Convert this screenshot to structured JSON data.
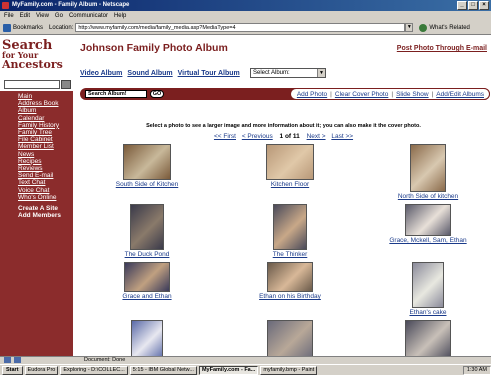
{
  "window": {
    "title": "MyFamily.com - Family Album - Netscape"
  },
  "menu": [
    "File",
    "Edit",
    "View",
    "Go",
    "Communicator",
    "Help"
  ],
  "location_bar": {
    "bookmarks_label": "Bookmarks",
    "location_label": "Location:",
    "url": "http://www.myfamily.com/media/family_media.asp?MediaType=4",
    "related_label": "What's Related"
  },
  "sidebar": {
    "logo_line1": "Search",
    "logo_line2": "for Your",
    "logo_line3": "Ancestors",
    "nav_items": [
      "Main",
      "Address Book",
      "Album",
      "Calendar",
      "Family History",
      "Family Tree",
      "File Cabinet",
      "Member List",
      "News",
      "Recipes",
      "Reviews",
      "Send E-mail",
      "Text Chat",
      "Voice Chat",
      "Who's Online"
    ],
    "bottom_items": [
      "Create A Site",
      "Add Members"
    ]
  },
  "main": {
    "title": "Johnson Family Photo Album",
    "post_link": "Post Photo Through E-mail",
    "album_links": [
      "Video Album",
      "Sound Album",
      "Virtual Tour Album"
    ],
    "select_album": "Select Album:",
    "search_value": "Search Album!",
    "go_label": "GO",
    "actions": [
      "Add Photo",
      "Clear Cover Photo",
      "Slide Show",
      "Add/Edit Albums"
    ],
    "instruction": "Select a photo to see a larger image and more information about it; you can also make it the cover photo.",
    "pager": {
      "first": "<< First",
      "previous": "< Previous",
      "count": "1 of 11",
      "next": "Next >",
      "last": "Last >>"
    }
  },
  "photos": [
    {
      "caption": "South Side of Kitchen",
      "colors": [
        "#7a5a3a",
        "#c8b89a"
      ]
    },
    {
      "caption": "Kitchen Floor",
      "colors": [
        "#b89878",
        "#e0c8a8"
      ]
    },
    {
      "caption": "North Side of kitchen",
      "colors": [
        "#8a6a4a",
        "#d8c8b0"
      ]
    },
    {
      "caption": "The Duck Pond",
      "colors": [
        "#3a3a4a",
        "#8a7a6a"
      ]
    },
    {
      "caption": "The Thinker",
      "colors": [
        "#4a4a5a",
        "#c8a888"
      ]
    },
    {
      "caption": "Grace, Mckell, Sam, Ethan",
      "colors": [
        "#5a5a6a",
        "#e8e0d8"
      ]
    },
    {
      "caption": "Grace and Ethan",
      "colors": [
        "#3a3a5a",
        "#c0a080"
      ]
    },
    {
      "caption": "Ethan on his Birthday",
      "colors": [
        "#6a5a4a",
        "#d8b898"
      ]
    },
    {
      "caption": "Ethan's cake",
      "colors": [
        "#8a8a9a",
        "#e8e8e0"
      ]
    },
    {
      "caption": "",
      "colors": [
        "#5a6aa8",
        "#e8e8f0"
      ]
    },
    {
      "caption": "",
      "colors": [
        "#6a6a7a",
        "#b8a898"
      ]
    },
    {
      "caption": "",
      "colors": [
        "#4a4a5a",
        "#c8c0b8"
      ]
    }
  ],
  "status": {
    "text": "Document: Done"
  },
  "taskbar": {
    "start": "Start",
    "tasks": [
      "Eudora Pro",
      "Exploring - D:\\COLLEC...",
      "5:15 - IBM Global Netw...",
      "MyFamily.com - Fa...",
      "myfamily.bmp - Paint"
    ],
    "clock": "1:30 AM"
  }
}
